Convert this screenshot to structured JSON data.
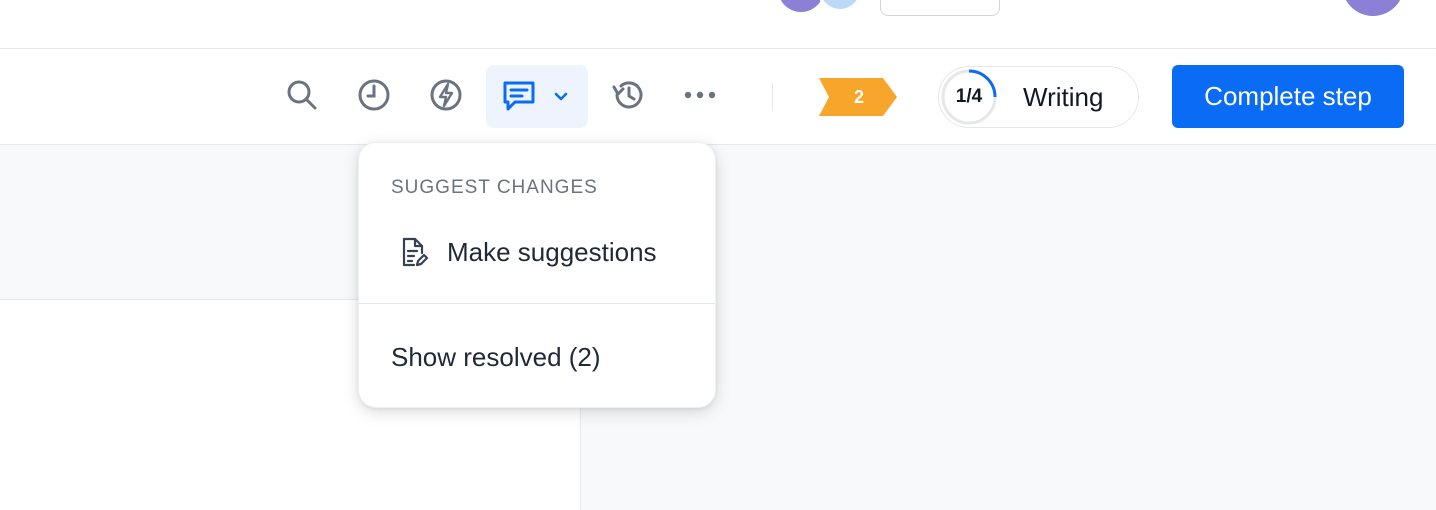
{
  "toolbar": {
    "icons": {
      "search": "search-icon",
      "clock": "clock-icon",
      "automation": "lightning-icon",
      "comments": "comment-icon",
      "caret": "chevron-down-icon",
      "history": "history-icon",
      "more": "more-horizontal-icon"
    },
    "badge": {
      "count": "2",
      "color": "#f8a52b"
    },
    "step": {
      "current": "1/4",
      "label": "Writing",
      "progress": 0.25,
      "ring_color": "#0a6cf5"
    },
    "complete_button": {
      "label": "Complete step",
      "color": "#0a6cf5"
    }
  },
  "dropdown": {
    "section_header": "SUGGEST CHANGES",
    "items": [
      {
        "label": "Make suggestions",
        "icon": "document-edit-icon"
      },
      {
        "label": "Show resolved (2)"
      }
    ]
  },
  "colors": {
    "accent": "#0a6cf5",
    "comments_active_bg": "#eef4fd",
    "icon_gray": "#6b7280"
  }
}
